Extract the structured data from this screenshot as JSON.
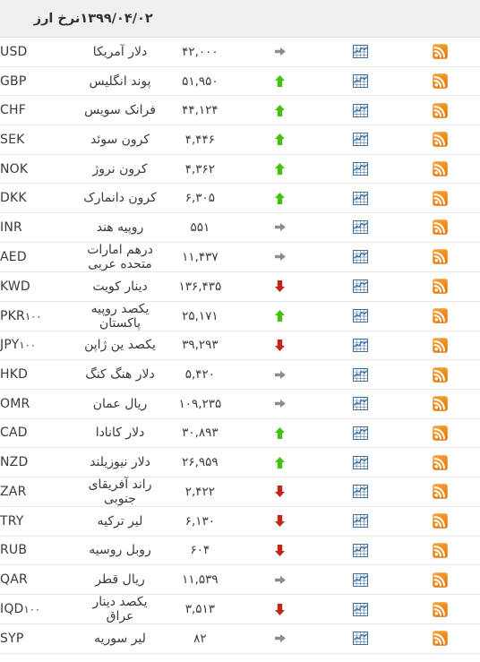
{
  "header": {
    "title": "نرخ ارز",
    "date": "۱۳۹۹/۰۴/۰۲",
    "rss_icon": "rss-icon",
    "chart_icon": "chart-icon"
  },
  "icons": {
    "rss": "rss-feed-icon",
    "chart": "line-chart-icon",
    "trend_up": "arrow-up-icon",
    "trend_down": "arrow-down-icon",
    "trend_flat": "arrow-right-icon"
  },
  "colors": {
    "up": "#44c011",
    "down": "#c0271a",
    "flat": "#8d8d8d",
    "rss": "#ee8c1c",
    "chart": "#3f6f9f",
    "header_bg": "#f0f0f0",
    "row_border": "#e6e6e6"
  },
  "rows": [
    {
      "code": "USD",
      "suffix": "",
      "name": "دلار آمریکا",
      "value": "۴۲,۰۰۰",
      "trend": "flat"
    },
    {
      "code": "GBP",
      "suffix": "",
      "name": "پوند انگلیس",
      "value": "۵۱,۹۵۰",
      "trend": "up"
    },
    {
      "code": "CHF",
      "suffix": "",
      "name": "فرانک سویس",
      "value": "۴۴,۱۲۴",
      "trend": "up"
    },
    {
      "code": "SEK",
      "suffix": "",
      "name": "کرون سوئد",
      "value": "۴,۴۴۶",
      "trend": "up"
    },
    {
      "code": "NOK",
      "suffix": "",
      "name": "کرون نروژ",
      "value": "۴,۳۶۲",
      "trend": "up"
    },
    {
      "code": "DKK",
      "suffix": "",
      "name": "کرون دانمارک",
      "value": "۶,۳۰۵",
      "trend": "up"
    },
    {
      "code": "INR",
      "suffix": "",
      "name": "روپیه هند",
      "value": "۵۵۱",
      "trend": "flat"
    },
    {
      "code": "AED",
      "suffix": "",
      "name": "درهم امارات متحده عربی",
      "value": "۱۱,۴۳۷",
      "trend": "flat"
    },
    {
      "code": "KWD",
      "suffix": "",
      "name": "دینار کویت",
      "value": "۱۳۶,۴۳۵",
      "trend": "down"
    },
    {
      "code": "PKR",
      "suffix": "۱۰۰",
      "name": "یکصد روپیه پاکستان",
      "value": "۲۵,۱۷۱",
      "trend": "up"
    },
    {
      "code": "JPY",
      "suffix": "۱۰۰",
      "name": "یکصد ین ژاپن",
      "value": "۳۹,۲۹۳",
      "trend": "down"
    },
    {
      "code": "HKD",
      "suffix": "",
      "name": "دلار هنگ کنگ",
      "value": "۵,۴۲۰",
      "trend": "flat"
    },
    {
      "code": "OMR",
      "suffix": "",
      "name": "ریال عمان",
      "value": "۱۰۹,۲۳۵",
      "trend": "flat"
    },
    {
      "code": "CAD",
      "suffix": "",
      "name": "دلار کانادا",
      "value": "۳۰,۸۹۳",
      "trend": "up"
    },
    {
      "code": "NZD",
      "suffix": "",
      "name": "دلار نیوزیلند",
      "value": "۲۶,۹۵۹",
      "trend": "up"
    },
    {
      "code": "ZAR",
      "suffix": "",
      "name": "راند آفریقای جنوبی",
      "value": "۲,۴۲۲",
      "trend": "down"
    },
    {
      "code": "TRY",
      "suffix": "",
      "name": "لیر ترکیه",
      "value": "۶,۱۳۰",
      "trend": "down"
    },
    {
      "code": "RUB",
      "suffix": "",
      "name": "روبل روسیه",
      "value": "۶۰۴",
      "trend": "down"
    },
    {
      "code": "QAR",
      "suffix": "",
      "name": "ریال قطر",
      "value": "۱۱,۵۳۹",
      "trend": "flat"
    },
    {
      "code": "IQD",
      "suffix": "۱۰۰",
      "name": "یکصد دینار عراق",
      "value": "۳,۵۱۳",
      "trend": "down"
    },
    {
      "code": "SYP",
      "suffix": "",
      "name": "لیر سوریه",
      "value": "۸۲",
      "trend": "flat"
    }
  ]
}
